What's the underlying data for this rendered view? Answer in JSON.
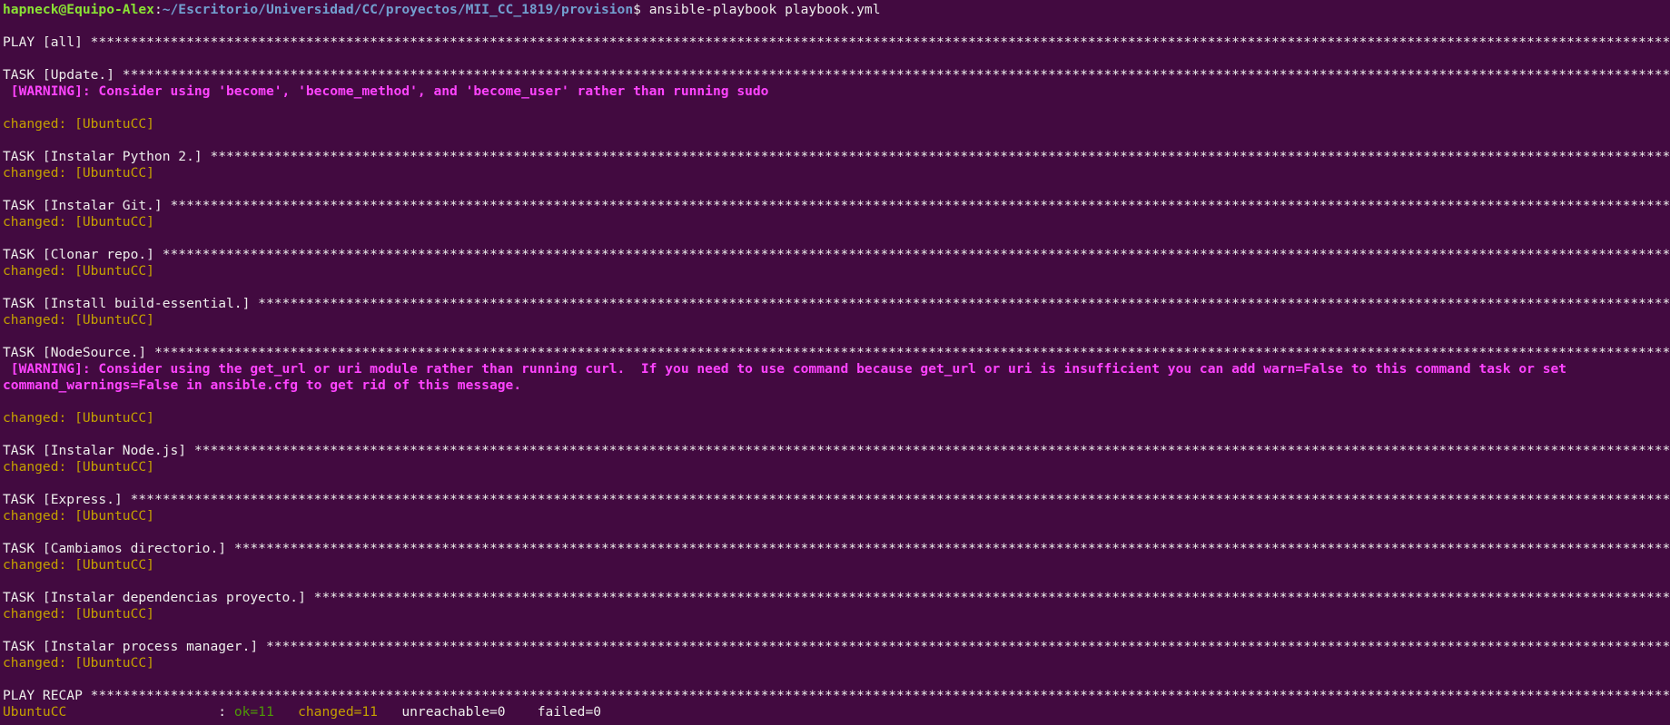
{
  "prompt": {
    "user_host": "hapneck@Equipo-Alex",
    "separator": ":",
    "path": "~/Escritorio/Universidad/CC/proyectos/MII_CC_1819/provision",
    "symbol": "$ ",
    "command": "ansible-playbook playbook.yml"
  },
  "play_header": "PLAY [all] ",
  "tasks": [
    {
      "header": "TASK [Update.] ",
      "warning": " [WARNING]: Consider using 'become', 'become_method', and 'become_user' rather than running sudo",
      "result": "changed: [UbuntuCC]"
    },
    {
      "header": "TASK [Instalar Python 2.] ",
      "result": "changed: [UbuntuCC]"
    },
    {
      "header": "TASK [Instalar Git.] ",
      "result": "changed: [UbuntuCC]"
    },
    {
      "header": "TASK [Clonar repo.] ",
      "result": "changed: [UbuntuCC]"
    },
    {
      "header": "TASK [Install build-essential.] ",
      "result": "changed: [UbuntuCC]"
    },
    {
      "header": "TASK [NodeSource.] ",
      "warning": " [WARNING]: Consider using the get_url or uri module rather than running curl.  If you need to use command because get_url or uri is insufficient you can add warn=False to this command task or set",
      "warning_cont": "command_warnings=False in ansible.cfg to get rid of this message.",
      "result": "changed: [UbuntuCC]"
    },
    {
      "header": "TASK [Instalar Node.js] ",
      "result": "changed: [UbuntuCC]"
    },
    {
      "header": "TASK [Express.] ",
      "result": "changed: [UbuntuCC]"
    },
    {
      "header": "TASK [Cambiamos directorio.] ",
      "result": "changed: [UbuntuCC]"
    },
    {
      "header": "TASK [Instalar dependencias proyecto.] ",
      "result": "changed: [UbuntuCC]"
    },
    {
      "header": "TASK [Instalar process manager.] ",
      "result": "changed: [UbuntuCC]"
    }
  ],
  "recap": {
    "header": "PLAY RECAP ",
    "host": "UbuntuCC",
    "colon": "                   : ",
    "ok": "ok=11",
    "changed": "changed=11",
    "unreachable": "unreachable=0",
    "failed": "failed=0"
  },
  "colors": {
    "background": "#420a40",
    "prompt_user": "#8ae234",
    "prompt_path": "#729fcf",
    "warning": "#ff44ff",
    "changed": "#c4a000",
    "ok": "#4e9a06"
  }
}
